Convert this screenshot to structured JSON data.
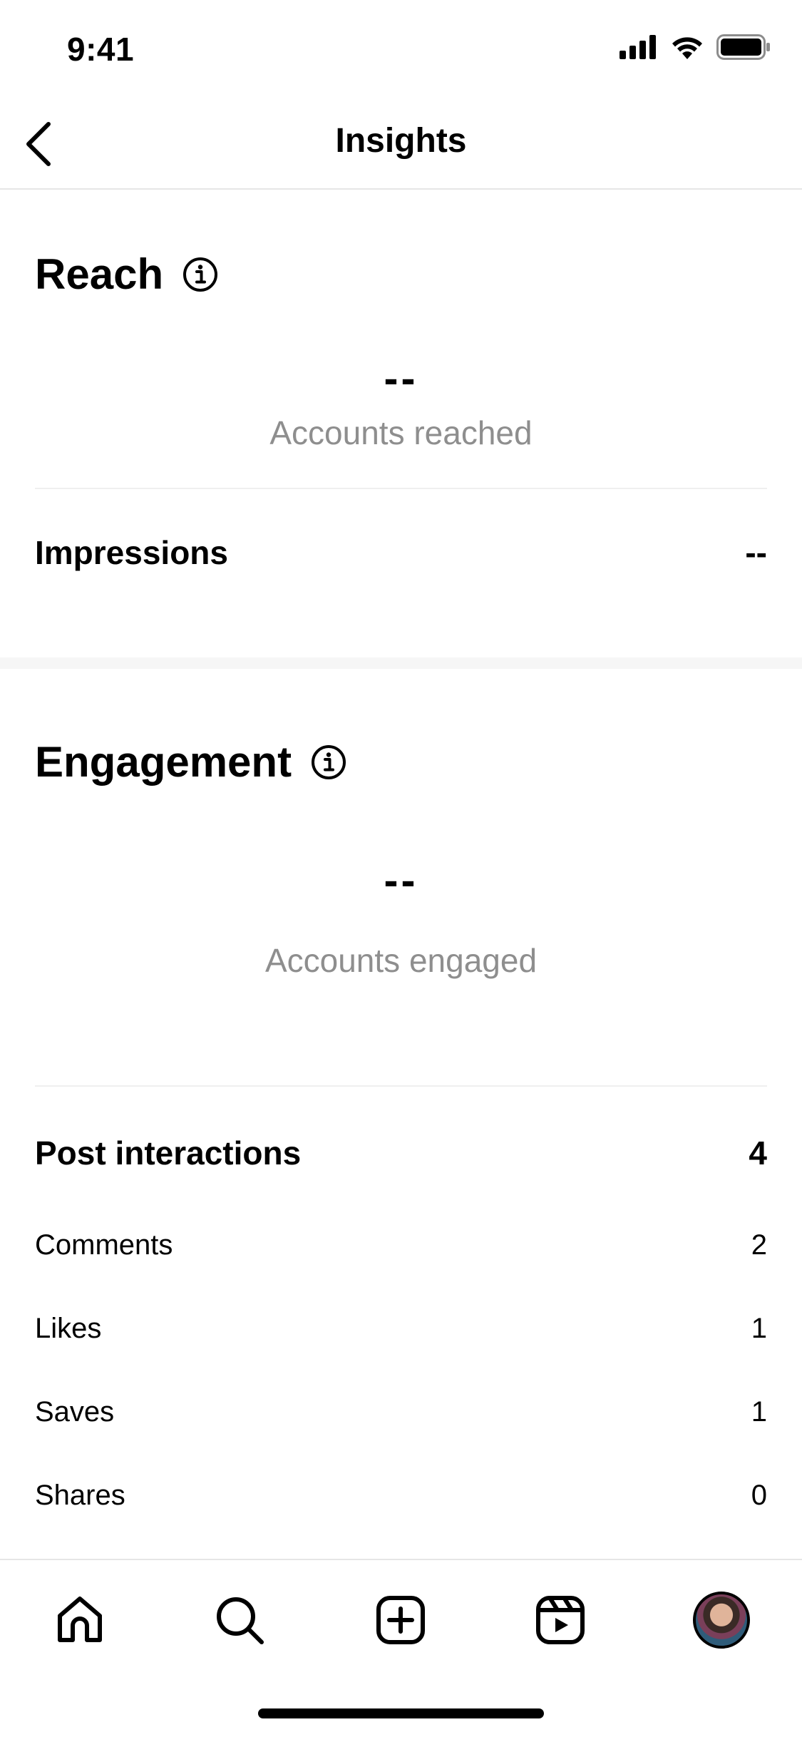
{
  "status_bar": {
    "time": "9:41"
  },
  "nav": {
    "title": "Insights"
  },
  "reach": {
    "title": "Reach",
    "accounts_reached_value": "--",
    "accounts_reached_label": "Accounts reached",
    "impressions_label": "Impressions",
    "impressions_value": "--"
  },
  "engagement": {
    "title": "Engagement",
    "accounts_engaged_value": "--",
    "accounts_engaged_label": "Accounts engaged",
    "post_interactions_label": "Post interactions",
    "post_interactions_value": "4",
    "items": [
      {
        "label": "Comments",
        "value": "2"
      },
      {
        "label": "Likes",
        "value": "1"
      },
      {
        "label": "Saves",
        "value": "1"
      },
      {
        "label": "Shares",
        "value": "0"
      }
    ]
  },
  "tab_bar": {
    "items": [
      "home-icon",
      "search-icon",
      "create-icon",
      "reels-icon",
      "profile-avatar"
    ]
  }
}
